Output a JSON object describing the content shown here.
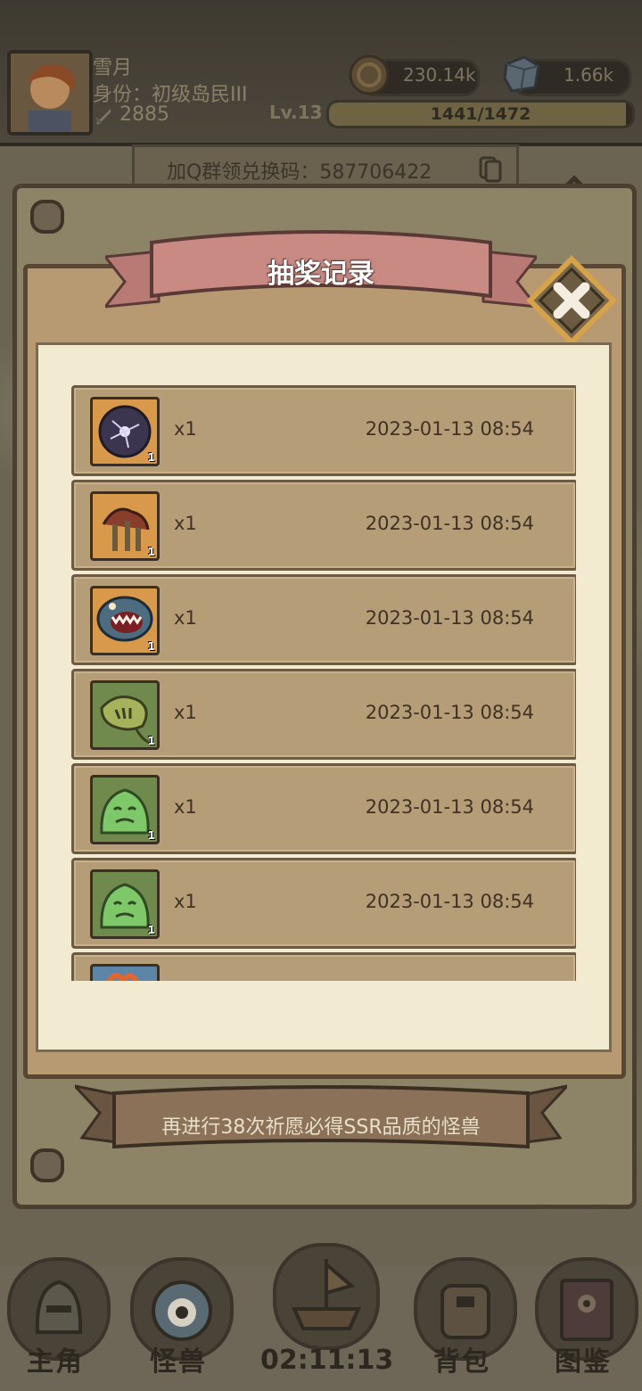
{
  "player": {
    "name": "雪月",
    "rank": "身份：初级岛民III",
    "power": "2885",
    "level": "Lv.13",
    "xp_text": "1441/1472",
    "xp_fraction": 0.979
  },
  "resources": {
    "gold": "230.14k",
    "stone": "1.66k"
  },
  "redeem_banner": "加Q群领兑换码：587706422",
  "modal": {
    "title": "抽奖记录",
    "footer": "再进行38次祈愿必得SSR品质的怪兽"
  },
  "records": [
    {
      "icon": "void-orb-icon",
      "badge": "1",
      "qty": "x1",
      "time": "2023-01-13 08:54",
      "frame": "#d89a4a"
    },
    {
      "icon": "mushroom-cluster-icon",
      "badge": "1",
      "qty": "x1",
      "time": "2023-01-13 08:54",
      "frame": "#d89a4a"
    },
    {
      "icon": "fanged-mouth-icon",
      "badge": "1",
      "qty": "x1",
      "time": "2023-01-13 08:54",
      "frame": "#d89a4a"
    },
    {
      "icon": "flytrap-plant-icon",
      "badge": "1",
      "qty": "x1",
      "time": "2023-01-13 08:54",
      "frame": "#6f8a4c"
    },
    {
      "icon": "green-slime-icon",
      "badge": "1",
      "qty": "x1",
      "time": "2023-01-13 08:54",
      "frame": "#6f8a4c"
    },
    {
      "icon": "green-slime-icon",
      "badge": "1",
      "qty": "x1",
      "time": "2023-01-13 08:54",
      "frame": "#6f8a4c"
    }
  ],
  "nav": {
    "hero": "主角",
    "monster": "怪兽",
    "bag": "背包",
    "atlas": "图鉴",
    "timer": "02:11:13"
  },
  "colors": {
    "ribbon": "#c98a84",
    "paper": "#f3ead2",
    "row": "#b59d78"
  }
}
